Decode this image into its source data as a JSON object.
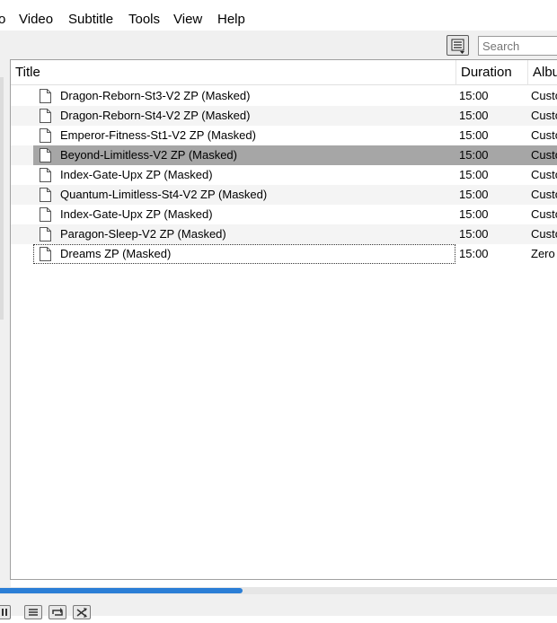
{
  "menu": {
    "items": [
      {
        "label": "o",
        "x": -1
      },
      {
        "label": "Video"
      },
      {
        "label": "Subtitle"
      },
      {
        "label": "Tools"
      },
      {
        "label": "View"
      },
      {
        "label": "Help"
      }
    ]
  },
  "toolbar": {
    "view_button_icon": "playlist-view-icon",
    "search_placeholder": "Search"
  },
  "playlist": {
    "columns": {
      "title": "Title",
      "duration": "Duration",
      "album": "Albu"
    },
    "rows": [
      {
        "title": "Dragon-Reborn-St3-V2 ZP (Masked)",
        "duration": "15:00",
        "album": "Custo"
      },
      {
        "title": "Dragon-Reborn-St4-V2 ZP (Masked)",
        "duration": "15:00",
        "album": "Custo"
      },
      {
        "title": "Emperor-Fitness-St1-V2 ZP (Masked)",
        "duration": "15:00",
        "album": "Custo"
      },
      {
        "title": "Beyond-Limitless-V2 ZP (Masked)",
        "duration": "15:00",
        "album": "Custo"
      },
      {
        "title": "Index-Gate-Upx ZP (Masked)",
        "duration": "15:00",
        "album": "Custo"
      },
      {
        "title": "Quantum-Limitless-St4-V2 ZP (Masked)",
        "duration": "15:00",
        "album": "Custo"
      },
      {
        "title": "Index-Gate-Upx ZP (Masked)",
        "duration": "15:00",
        "album": "Custo"
      },
      {
        "title": "Paragon-Sleep-V2 ZP (Masked)",
        "duration": "15:00",
        "album": "Custo"
      },
      {
        "title": "Dreams ZP (Masked)",
        "duration": "15:00",
        "album": "Zero"
      }
    ],
    "selected_index": 3,
    "focused_index": 8
  },
  "seek": {
    "progress": 0.435
  },
  "colors": {
    "selection": "#a6a6a6",
    "seek_fill": "#2b7ed6",
    "toolbar_bg": "#f0f0f0"
  }
}
